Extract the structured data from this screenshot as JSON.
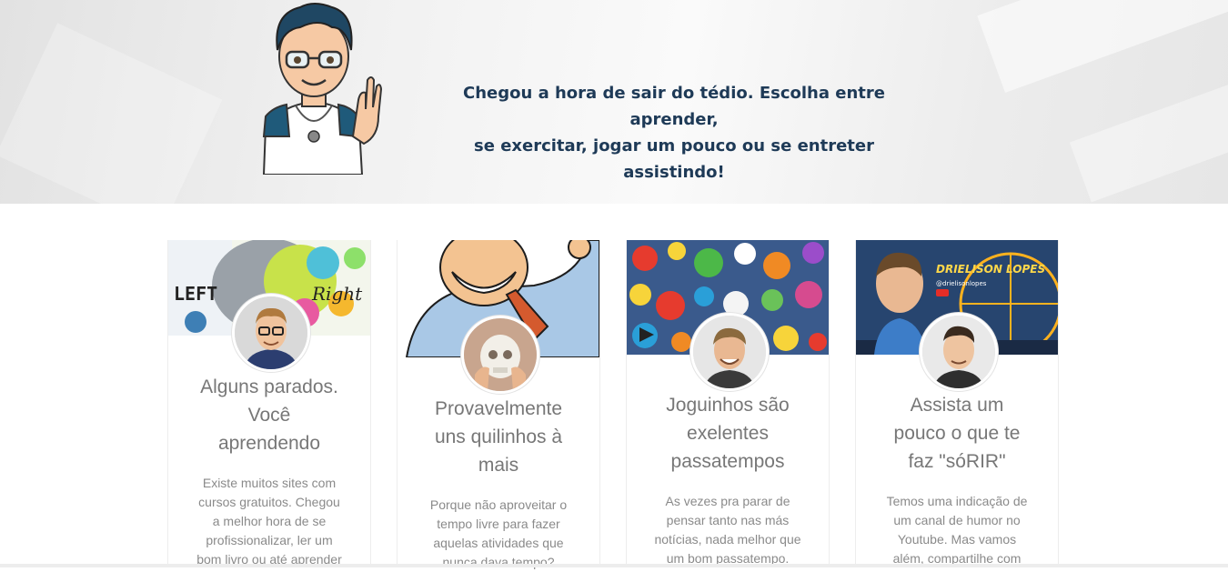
{
  "hero": {
    "line1": "Chegou a hora de sair do tédio. Escolha entre aprender,",
    "line2": "se exercitar, jogar um pouco ou se entreter assistindo!"
  },
  "cards": [
    {
      "title_lines": [
        "Alguns parados.",
        "Você",
        "aprendendo"
      ],
      "desc_lines": [
        "Existe muitos sites com",
        "cursos gratuitos. Chegou",
        "a melhor hora de se",
        "profissionalizar, ler um",
        "bom livro ou até aprender"
      ],
      "banner_words": [
        "LEFT",
        "Right"
      ]
    },
    {
      "title_lines": [
        "Provavelmente",
        "uns quilinhos à",
        "mais"
      ],
      "desc_lines": [
        "Porque não aproveitar o",
        "tempo livre para fazer",
        "aquelas atividades que",
        "nunca dava tempo?"
      ]
    },
    {
      "title_lines": [
        "Joguinhos são",
        "exelentes",
        "passatempos"
      ],
      "desc_lines": [
        "As vezes pra parar de",
        "pensar tanto nas más",
        "notícias, nada melhor que",
        "um bom passatempo."
      ]
    },
    {
      "title_lines": [
        "Assista um",
        "pouco o que te",
        "faz \"sóRIR\""
      ],
      "desc_lines": [
        "Temos uma indicação de",
        "um canal de humor no",
        "Youtube. Mas vamos",
        "além, compartilhe com"
      ],
      "banner_words": [
        "DRIELISON LOPES",
        "@drielisonlopes"
      ]
    }
  ]
}
